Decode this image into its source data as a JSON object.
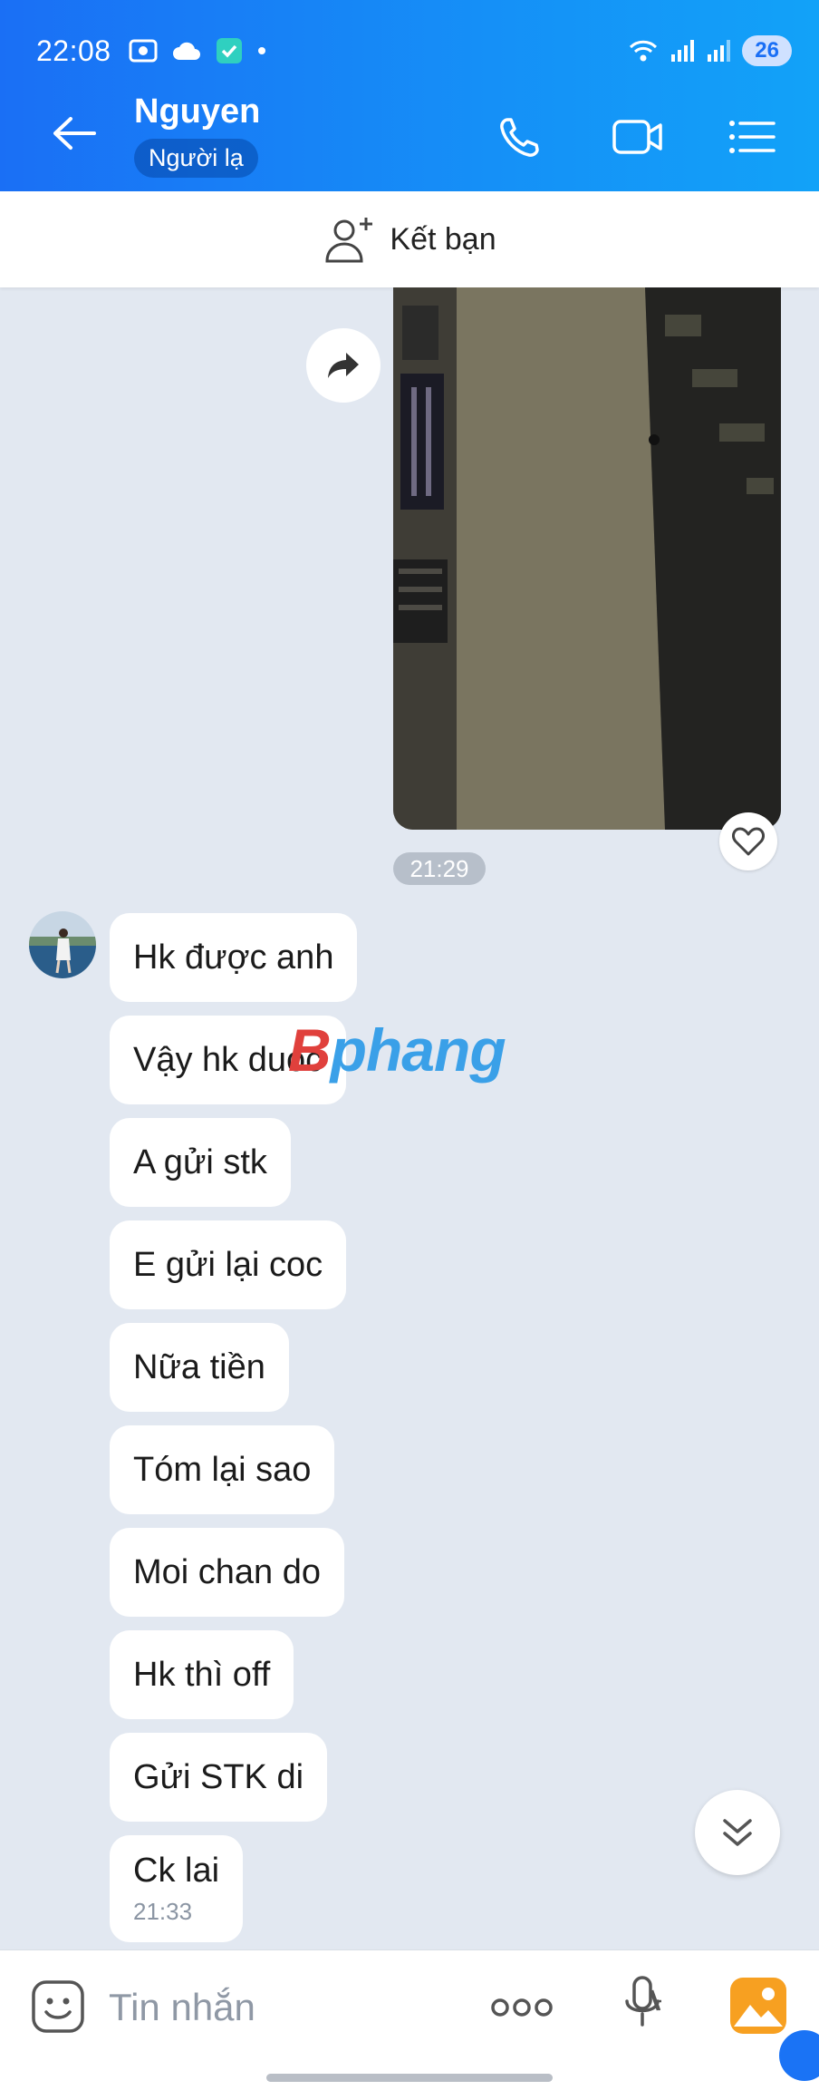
{
  "status_bar": {
    "time": "22:08",
    "battery": "26"
  },
  "header": {
    "title": "Nguyen",
    "badge": "Người lạ"
  },
  "friend_bar": {
    "label": "Kết bạn"
  },
  "media": {
    "time_label": "21:29"
  },
  "messages": [
    "Hk được anh",
    "Vậy hk duoc",
    "A gửi stk",
    "E gửi lại coc",
    "Nữa tiền",
    "Tóm lại sao",
    "Moi chan do",
    "Hk thì off",
    "Gửi STK di",
    "Ck lai"
  ],
  "last_message_time": "21:33",
  "watermark": {
    "first": "B",
    "rest": "phang"
  },
  "composer": {
    "placeholder": "Tin nhắn"
  },
  "colors": {
    "header_start": "#1a6ff5",
    "header_end": "#12a2f8",
    "chat_bg": "#e2e8f1"
  },
  "icons": [
    "back-arrow-icon",
    "phone-icon",
    "video-call-icon",
    "menu-list-icon",
    "add-friend-icon",
    "forward-icon",
    "heart-icon",
    "scroll-down-icon",
    "emoji-icon",
    "more-dots-icon",
    "mic-icon",
    "gallery-icon"
  ]
}
